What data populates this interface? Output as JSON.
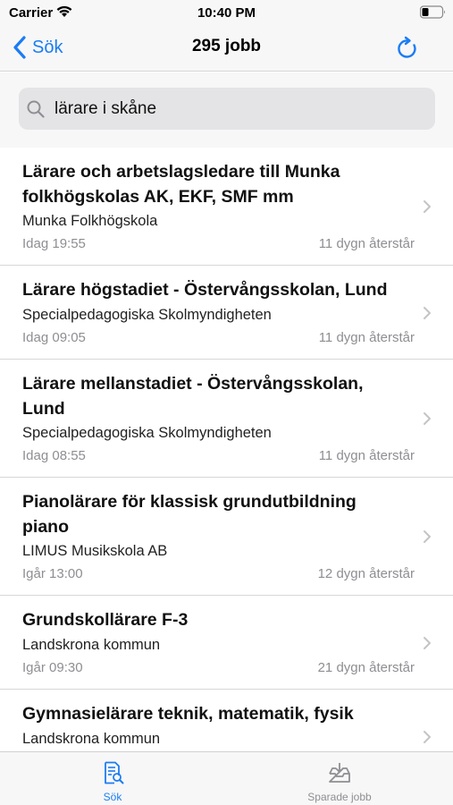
{
  "status_bar": {
    "carrier": "Carrier",
    "time": "10:40 PM"
  },
  "nav": {
    "back_label": "Sök",
    "title": "295 jobb"
  },
  "search": {
    "value": "lärare i skåne"
  },
  "jobs": [
    {
      "title": "Lärare och arbetslagsledare till Munka folkhögskolas AK, EKF, SMF mm",
      "employer": "Munka Folkhögskola",
      "date": "Idag 19:55",
      "remaining": "11 dygn återstår"
    },
    {
      "title": "Lärare högstadiet - Östervångsskolan, Lund",
      "employer": "Specialpedagogiska Skolmyndigheten",
      "date": "Idag 09:05",
      "remaining": "11 dygn återstår"
    },
    {
      "title": "Lärare mellanstadiet - Östervångsskolan, Lund",
      "employer": "Specialpedagogiska Skolmyndigheten",
      "date": "Idag 08:55",
      "remaining": "11 dygn återstår"
    },
    {
      "title": "Pianolärare för klassisk grundutbildning piano",
      "employer": "LIMUS Musikskola AB",
      "date": "Igår 13:00",
      "remaining": "12 dygn återstår"
    },
    {
      "title": "Grundskollärare F-3",
      "employer": "Landskrona kommun",
      "date": "Igår 09:30",
      "remaining": "21 dygn återstår"
    },
    {
      "title": "Gymnasielärare teknik, matematik, fysik",
      "employer": "Landskrona kommun",
      "date": "",
      "remaining": ""
    }
  ],
  "tabs": [
    {
      "label": "Sök",
      "icon": "document-search-icon",
      "active": true
    },
    {
      "label": "Sparade jobb",
      "icon": "inbox-download-icon",
      "active": false
    }
  ],
  "colors": {
    "accent": "#1a7cf5",
    "inactive": "#8e8e93",
    "secondary_text": "#8e8e93",
    "bar_background": "#f7f7f7"
  }
}
